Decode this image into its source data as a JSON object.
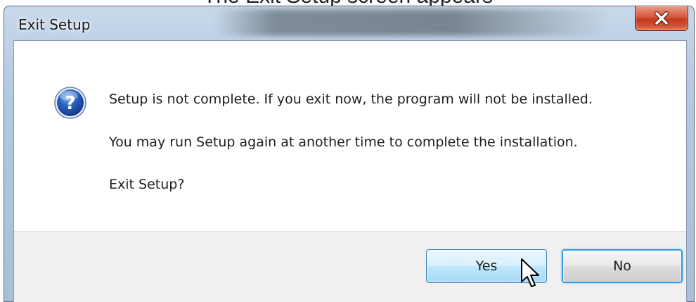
{
  "caption": {
    "text": "The Exit Setup screen appears"
  },
  "window": {
    "title": "Exit Setup",
    "close_icon": "close-x-icon"
  },
  "message": {
    "icon": "question-icon",
    "line1": "Setup is not complete. If you exit now, the program will not be installed.",
    "line2": "You may run Setup again at another time to complete the installation.",
    "line3": "Exit Setup?"
  },
  "buttons": {
    "yes_label": "Yes",
    "no_label": "No"
  },
  "pointer": {
    "icon": "mouse-pointer-icon"
  },
  "colors": {
    "close_button": "#c9452b",
    "yes_button_hover": "#bee6fd",
    "focus_border": "#3399dd",
    "question_icon_blue": "#1f4fa8"
  }
}
